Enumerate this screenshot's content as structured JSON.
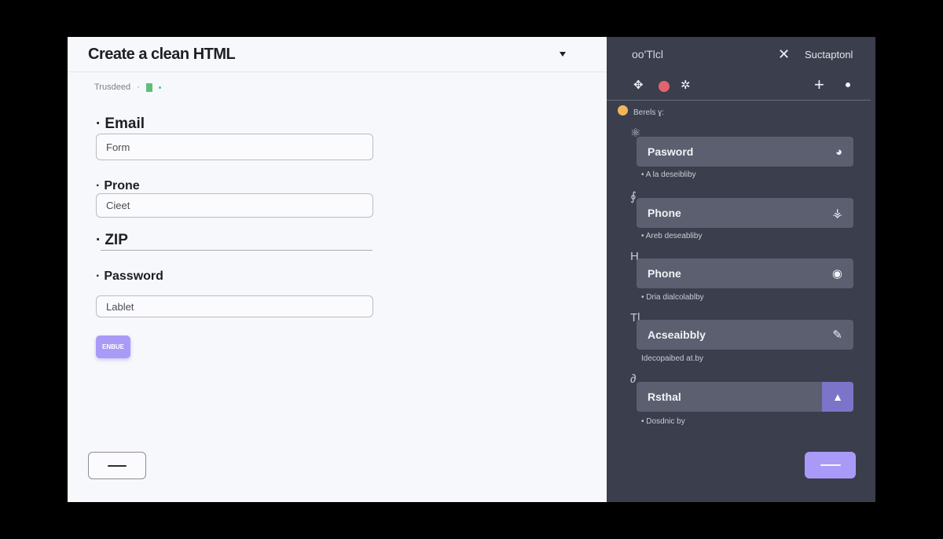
{
  "form": {
    "title": "Create a clean HTML",
    "subline": "Trusdeed",
    "subline_sep": "·",
    "fields": [
      {
        "label": "Email",
        "bullet": "·",
        "value": "Form"
      },
      {
        "label": "Prone",
        "bullet": "·",
        "value": "Cieet"
      },
      {
        "label": "ZIP",
        "bullet": "·",
        "value": ""
      },
      {
        "label": "Password",
        "bullet": "·",
        "value": "Lablet"
      }
    ],
    "submit_label": "ENBUE"
  },
  "side": {
    "title": "oo'Tlcl",
    "close_glyph": "✕",
    "action_label": "Suctaptonl",
    "tools": [
      "✥",
      "✲"
    ],
    "plus_glyph": "+",
    "section_label": "Berels ɣ:",
    "items": [
      {
        "glyph": "⚛",
        "label": "Pasword",
        "icon": "◕",
        "caption": "• A la deseibliby"
      },
      {
        "glyph": "∮",
        "label": "Phone",
        "icon": "⚶",
        "caption": "• Areb deseabliby"
      },
      {
        "glyph": "H",
        "label": "Phone",
        "icon": "◉",
        "caption": "• Dria dialcolablby"
      },
      {
        "glyph": "Tl",
        "label": "Acseaibbly",
        "icon": "✎",
        "caption": "Idecopaibed at.by"
      },
      {
        "glyph": "∂",
        "label": "Rsthal",
        "icon": "▲",
        "caption": "• Dosdnic by"
      }
    ]
  },
  "colors": {
    "accent": "#a99af7",
    "panel_dark": "#3b3e4c",
    "row_bg": "#5b5f6f",
    "status_red": "#e0636f",
    "status_yellow": "#f2b55b"
  },
  "icons": {
    "caret": "chevron-down-icon",
    "close": "close-icon",
    "plus": "plus-icon",
    "menu": "minus-icon"
  }
}
